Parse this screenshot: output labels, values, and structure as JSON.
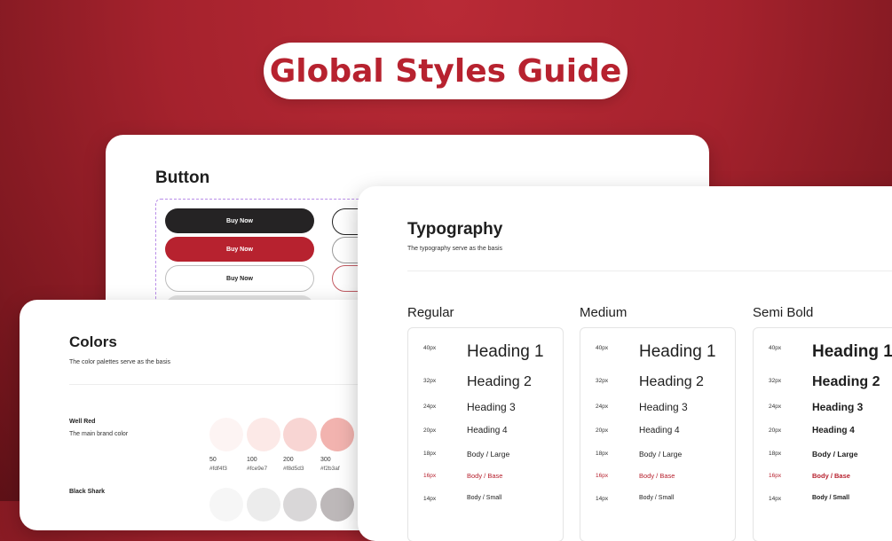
{
  "banner": {
    "title": "Global Styles Guide"
  },
  "button_card": {
    "title": "Button",
    "buttons": [
      "Buy Now",
      "Buy Now",
      "Buy Now"
    ]
  },
  "colors_card": {
    "title": "Colors",
    "subtitle": "The color palettes serve as the basis",
    "groups": [
      {
        "name": "Well Red",
        "desc": "The main brand color",
        "swatches": [
          {
            "num": "50",
            "hex": "#fdf4f3",
            "color": "#fdf4f3"
          },
          {
            "num": "100",
            "hex": "#fce9e7",
            "color": "#fce9e7"
          },
          {
            "num": "200",
            "hex": "#f8d5d3",
            "color": "#f8d5d3"
          },
          {
            "num": "300",
            "hex": "#f2b3af",
            "color": "#f2b3af"
          }
        ]
      },
      {
        "name": "Black Shark",
        "swatches": [
          {
            "color": "#f6f6f6"
          },
          {
            "color": "#ececec"
          },
          {
            "color": "#d9d7d8"
          },
          {
            "color": "#bdb8b9"
          }
        ]
      }
    ]
  },
  "type_card": {
    "title": "Typography",
    "subtitle": "The typography serve as the basis",
    "columns": [
      {
        "name": "Regular",
        "weight": "normal"
      },
      {
        "name": "Medium",
        "weight": "normal"
      },
      {
        "name": "Semi Bold",
        "weight": "bold"
      }
    ],
    "rows": [
      {
        "size": "40px",
        "label": "Heading 1"
      },
      {
        "size": "32px",
        "label": "Heading 2"
      },
      {
        "size": "24px",
        "label": "Heading 3"
      },
      {
        "size": "20px",
        "label": "Heading 4"
      },
      {
        "size": "18px",
        "label": "Body / Large"
      },
      {
        "size": "16px",
        "label": "Body / Base",
        "accent": true
      },
      {
        "size": "14px",
        "label": "Body / Small"
      }
    ]
  },
  "colors": {
    "brand": "#b7222f",
    "dark": "#252324"
  }
}
